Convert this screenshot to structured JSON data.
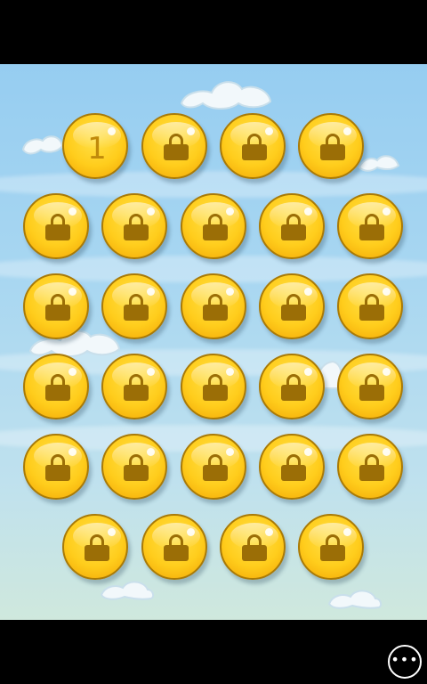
{
  "level_select": {
    "levels": [
      {
        "label": "1",
        "locked": false
      },
      {
        "label": "",
        "locked": true
      },
      {
        "label": "",
        "locked": true
      },
      {
        "label": "",
        "locked": true
      },
      {
        "label": "",
        "locked": true
      },
      {
        "label": "",
        "locked": true
      },
      {
        "label": "",
        "locked": true
      },
      {
        "label": "",
        "locked": true
      },
      {
        "label": "",
        "locked": true
      },
      {
        "label": "",
        "locked": true
      },
      {
        "label": "",
        "locked": true
      },
      {
        "label": "",
        "locked": true
      },
      {
        "label": "",
        "locked": true
      },
      {
        "label": "",
        "locked": true
      },
      {
        "label": "",
        "locked": true
      },
      {
        "label": "",
        "locked": true
      },
      {
        "label": "",
        "locked": true
      },
      {
        "label": "",
        "locked": true
      },
      {
        "label": "",
        "locked": true
      },
      {
        "label": "",
        "locked": true
      },
      {
        "label": "",
        "locked": true
      },
      {
        "label": "",
        "locked": true
      },
      {
        "label": "",
        "locked": true
      },
      {
        "label": "",
        "locked": true
      },
      {
        "label": "",
        "locked": true
      },
      {
        "label": "",
        "locked": true
      },
      {
        "label": "",
        "locked": true
      },
      {
        "label": "",
        "locked": true
      }
    ],
    "locked_icon": "lock-icon"
  },
  "app_bar": {
    "more_label": "•••",
    "more_icon": "ellipsis-icon"
  },
  "colors": {
    "sky_top": "#96cdf1",
    "sky_bottom": "#cfe8dd",
    "coin": "#ffcd1c",
    "coin_border": "#a97a07",
    "lock": "#9b6e06"
  }
}
